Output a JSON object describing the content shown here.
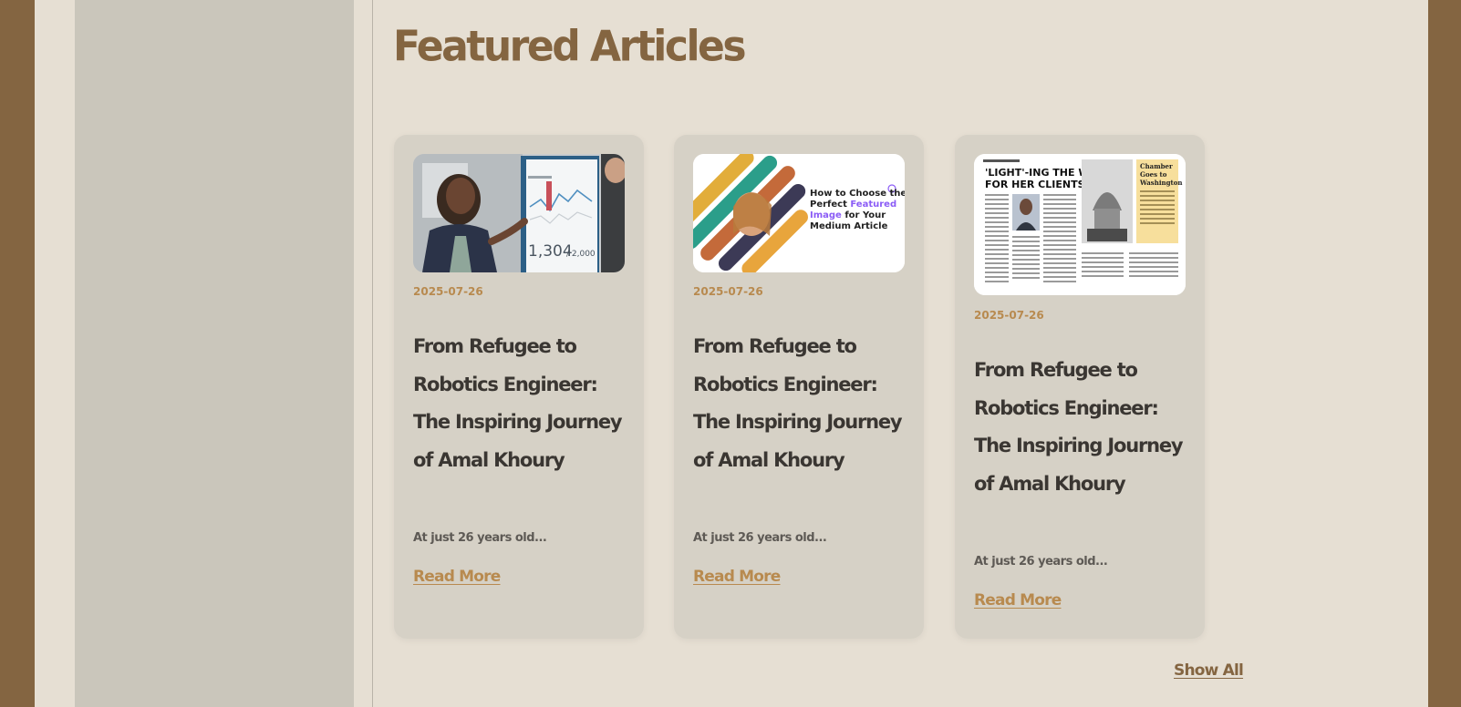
{
  "section": {
    "title": "Featured Articles",
    "show_all_label": "Show All"
  },
  "articles": [
    {
      "date": "2025-07-26",
      "title": "From Refugee to Robotics Engineer: The Inspiring Journey of Amal Khoury",
      "excerpt": "At just 26 years old...",
      "read_more": "Read More",
      "image": {
        "kind": "photo-presenter-dashboard",
        "chart_number": "1,304",
        "chart_total": "/ 2,000"
      }
    },
    {
      "date": "2025-07-26",
      "title": "From Refugee to Robotics Engineer: The Inspiring Journey of Amal Khoury",
      "excerpt": "At just 26 years old...",
      "read_more": "Read More",
      "image": {
        "kind": "graphic-featured-image",
        "line1": "How to Choose the",
        "line2_pre": "Perfect ",
        "line2_hl": "Featured",
        "line3_hl": "Image",
        "line3_post": " for Your",
        "line4": "Medium Article",
        "highlight_color": "#8b5cf6"
      }
    },
    {
      "date": "2025-07-26",
      "title": "From Refugee to Robotics Engineer: The Inspiring Journey of Amal Khoury",
      "excerpt": "At just 26 years old...",
      "read_more": "Read More",
      "image": {
        "kind": "newspaper-clipping",
        "headline_1": "'LIGHT'-ING THE WAY",
        "headline_2": "FOR HER CLIENTS",
        "side_1": "Chamber",
        "side_2": "Goes to",
        "side_3": "Washington"
      }
    }
  ],
  "colors": {
    "outer": "#846541",
    "page": "#e6dfd3",
    "sidebar": "#cac6bb",
    "card": "#d6d1c6",
    "heading": "#846541",
    "accent": "#b88a4f",
    "text": "#3a3632"
  }
}
